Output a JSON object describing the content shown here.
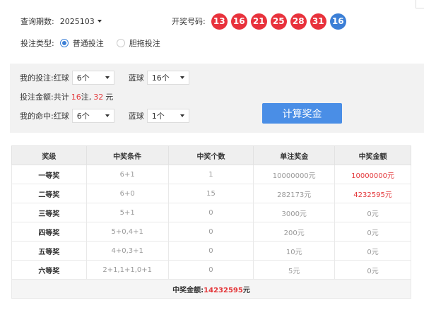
{
  "query": {
    "period_label": "查询期数:",
    "period_value": "2025103"
  },
  "draw": {
    "label": "开奖号码:",
    "red_balls": [
      "13",
      "16",
      "21",
      "25",
      "28",
      "31"
    ],
    "blue_balls": [
      "16"
    ],
    "red_color": "#e8323c",
    "blue_color": "#3b7fd6"
  },
  "bet_type": {
    "label": "投注类型:",
    "options": [
      {
        "label": "普通投注",
        "selected": true
      },
      {
        "label": "胆拖投注",
        "selected": false
      }
    ]
  },
  "my_bet": {
    "label": "我的投注:",
    "red_label": "红球",
    "red_value": "6个",
    "blue_label": "蓝球",
    "blue_value": "16个"
  },
  "amount": {
    "prefix": "投注金额:共计",
    "count": "16",
    "count_unit": "注,",
    "money": "32",
    "money_unit": "元"
  },
  "my_hit": {
    "label": "我的命中:",
    "red_label": "红球",
    "red_value": "6个",
    "blue_label": "蓝球",
    "blue_value": "1个"
  },
  "calc_button": "计算奖金",
  "table": {
    "headers": [
      "奖级",
      "中奖条件",
      "中奖个数",
      "单注奖金",
      "中奖金额"
    ],
    "rows": [
      {
        "level": "一等奖",
        "cond": "6+1",
        "count": "1",
        "unit": "10000000元",
        "total": "10000000元",
        "hl": true
      },
      {
        "level": "二等奖",
        "cond": "6+0",
        "count": "15",
        "unit": "282173元",
        "total": "4232595元",
        "hl": true
      },
      {
        "level": "三等奖",
        "cond": "5+1",
        "count": "0",
        "unit": "3000元",
        "total": "0元",
        "hl": false
      },
      {
        "level": "四等奖",
        "cond": "5+0,4+1",
        "count": "0",
        "unit": "200元",
        "total": "0元",
        "hl": false
      },
      {
        "level": "五等奖",
        "cond": "4+0,3+1",
        "count": "0",
        "unit": "10元",
        "total": "0元",
        "hl": false
      },
      {
        "level": "六等奖",
        "cond": "2+1,1+1,0+1",
        "count": "0",
        "unit": "5元",
        "total": "0元",
        "hl": false
      }
    ],
    "total_label": "中奖金额:",
    "total_value": "14232595",
    "total_unit": "元"
  }
}
